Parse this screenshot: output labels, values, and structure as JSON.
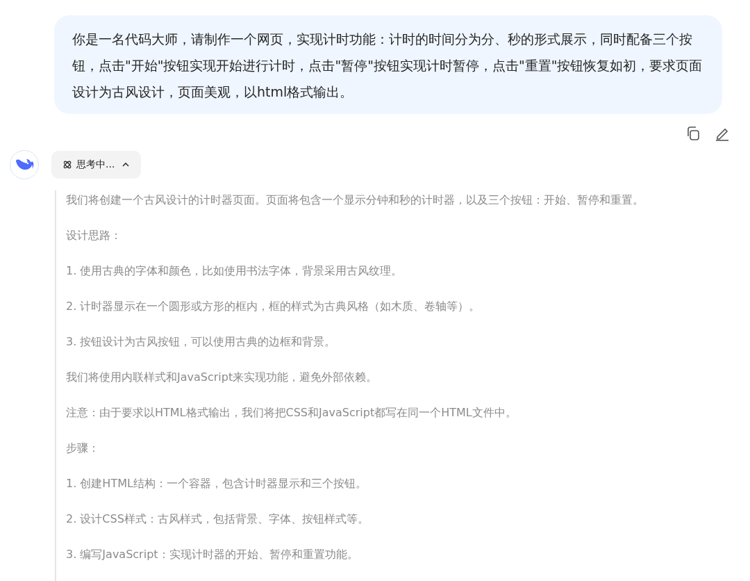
{
  "user_message": {
    "text": "你是一名代码大师，请制作一个网页，实现计时功能：计时的时间分为分、秒的形式展示，同时配备三个按钮，点击\"开始\"按钮实现开始进行计时，点击\"暂停\"按钮实现计时暂停，点击\"重置\"按钮恢复如初，要求页面设计为古风设计，页面美观，以html格式输出。"
  },
  "thinking": {
    "label": "思考中...",
    "expanded": true,
    "paragraphs": [
      "我们将创建一个古风设计的计时器页面。页面将包含一个显示分钟和秒的计时器，以及三个按钮：开始、暂停和重置。",
      "设计思路：",
      "1. 使用古典的字体和颜色，比如使用书法字体，背景采用古风纹理。",
      "2. 计时器显示在一个圆形或方形的框内，框的样式为古典风格（如木质、卷轴等）。",
      "3. 按钮设计为古风按钮，可以使用古典的边框和背景。",
      "我们将使用内联样式和JavaScript来实现功能，避免外部依赖。",
      "注意：由于要求以HTML格式输出，我们将把CSS和JavaScript都写在同一个HTML文件中。",
      "步骤：",
      "1. 创建HTML结构：一个容器，包含计时器显示和三个按钮。",
      "2. 设计CSS样式：古风样式，包括背景、字体、按钮样式等。",
      "3. 编写JavaScript：实现计时器的开始、暂停和重置功能。"
    ]
  }
}
